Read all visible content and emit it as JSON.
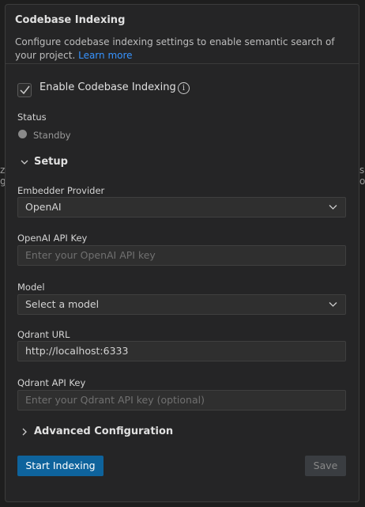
{
  "panel": {
    "title": "Codebase Indexing",
    "description": "Configure codebase indexing settings to enable semantic search of your project.",
    "learn_more": "Learn more"
  },
  "enable": {
    "label": "Enable Codebase Indexing",
    "checked": true,
    "info_icon": "i"
  },
  "status": {
    "label": "Status",
    "value": "Standby",
    "dot_color": "#8a8a8a"
  },
  "setup": {
    "label": "Setup",
    "expanded": true
  },
  "fields": {
    "embedder": {
      "label": "Embedder Provider",
      "value": "OpenAI"
    },
    "openai_key": {
      "label": "OpenAI API Key",
      "placeholder": "Enter your OpenAI API key"
    },
    "model": {
      "label": "Model",
      "value": "Select a model"
    },
    "qdrant_url": {
      "label": "Qdrant URL",
      "value": "http://localhost:6333"
    },
    "qdrant_key": {
      "label": "Qdrant API Key",
      "placeholder": "Enter your Qdrant API key (optional)"
    }
  },
  "advanced": {
    "label": "Advanced Configuration",
    "expanded": false
  },
  "buttons": {
    "start": "Start Indexing",
    "save": "Save"
  },
  "colors": {
    "accent": "#0e639c",
    "link": "#3794ff",
    "background": "#1e1e1e",
    "panel": "#252526"
  }
}
